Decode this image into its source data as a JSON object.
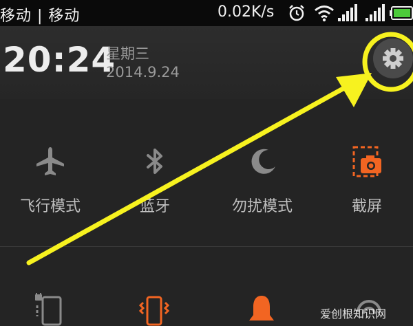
{
  "status_bar": {
    "carrier": "移动 | 移动",
    "net_speed": "0.02K/s",
    "icons": [
      "alarm-icon",
      "wifi-icon",
      "signal-icon",
      "signal-icon",
      "battery-icon"
    ]
  },
  "header": {
    "time": "20:24",
    "weekday": "星期三",
    "date": "2014.9.24",
    "settings_icon": "gear-icon"
  },
  "toggles": [
    {
      "label": "飞行模式",
      "icon": "airplane-icon"
    },
    {
      "label": "蓝牙",
      "icon": "bluetooth-icon"
    },
    {
      "label": "勿扰模式",
      "icon": "moon-icon"
    },
    {
      "label": "截屏",
      "icon": "screenshot-icon"
    }
  ],
  "second_row_icons": [
    "rotation-lock-icon",
    "vibrate-icon",
    "bell-icon",
    "sync-icon"
  ],
  "annotation": {
    "color": "#f7f21f"
  },
  "watermark": "爱创根知识网",
  "colors": {
    "accent": "#f26522",
    "icon_gray": "#8a8a8a"
  }
}
